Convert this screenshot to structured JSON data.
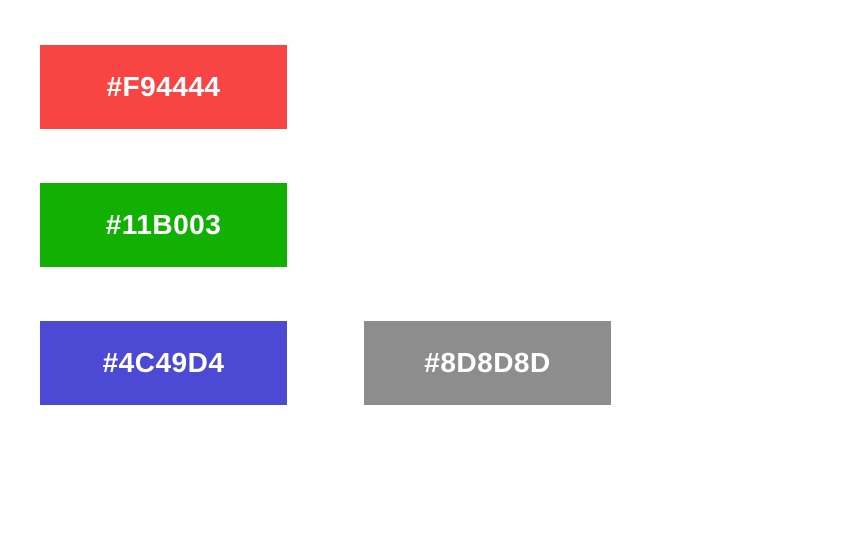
{
  "swatches": [
    {
      "label": "#F94444",
      "color": "#F94444"
    },
    {
      "label": "#11B003",
      "color": "#11B003"
    },
    {
      "label": "#4C49D4",
      "color": "#4C49D4"
    },
    {
      "label": "#8D8D8D",
      "color": "#8D8D8D"
    }
  ]
}
